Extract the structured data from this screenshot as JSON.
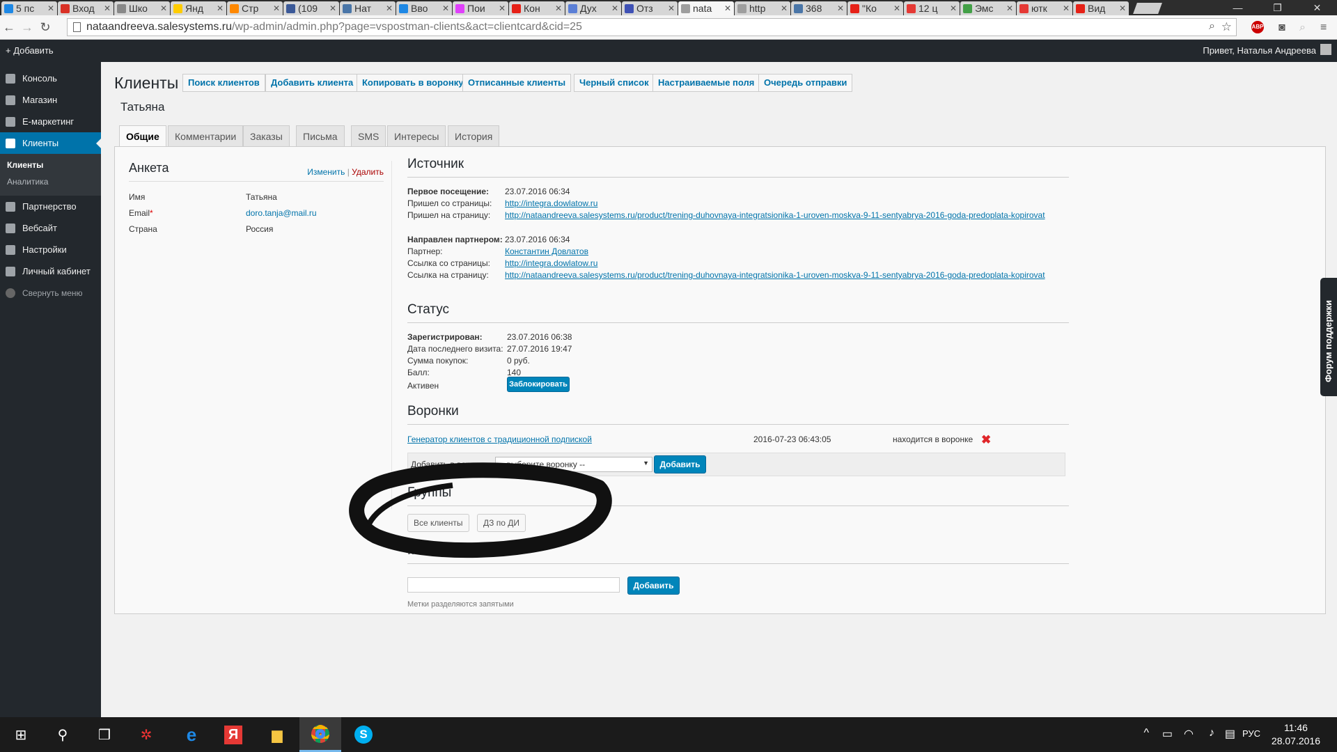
{
  "browser": {
    "tabs": [
      {
        "label": "5 пс",
        "color": "#1e88e5"
      },
      {
        "label": "Вход",
        "color": "#d93025"
      },
      {
        "label": "Шко",
        "color": "#888888"
      },
      {
        "label": "Янд",
        "color": "#ffcc00"
      },
      {
        "label": "Стр",
        "color": "#ff8800"
      },
      {
        "label": "(109",
        "color": "#3b5998"
      },
      {
        "label": "Нат",
        "color": "#4a76a8"
      },
      {
        "label": "Вво",
        "color": "#1e88e5"
      },
      {
        "label": "Пои",
        "color": "#e040fb"
      },
      {
        "label": "Кон",
        "color": "#e62117"
      },
      {
        "label": "Дух",
        "color": "#5b7fd6"
      },
      {
        "label": "Отз",
        "color": "#3f51b5"
      },
      {
        "label": "nata",
        "color": "#9e9e9e",
        "active": true
      },
      {
        "label": "http",
        "color": "#9e9e9e"
      },
      {
        "label": "368",
        "color": "#4a76a8"
      },
      {
        "label": "\"Ко",
        "color": "#e62117"
      },
      {
        "label": "12 ц",
        "color": "#e53935"
      },
      {
        "label": "Эмс",
        "color": "#43a047"
      },
      {
        "label": "ютк",
        "color": "#e53935"
      },
      {
        "label": "Вид",
        "color": "#e62117"
      }
    ],
    "url_host": "nataandreeva.salesystems.ru",
    "url_path": "/wp-admin/admin.php?page=vspostman-clients&act=clientcard&cid=25",
    "abp": "ABP"
  },
  "adminbar": {
    "add": "Добавить",
    "hello": "Привет, Наталья Андреева"
  },
  "sidebar": {
    "items_top": [
      {
        "label": "Консоль",
        "icon": "dashboard-icon"
      },
      {
        "label": "Магазин",
        "icon": "store-icon"
      },
      {
        "label": "Е-маркетинг",
        "icon": "marketing-icon"
      },
      {
        "label": "Клиенты",
        "icon": "clients-icon",
        "current": true
      }
    ],
    "sub": [
      "Клиенты",
      "Аналитика"
    ],
    "items_bottom": [
      {
        "label": "Партнерство",
        "icon": "partner-icon"
      },
      {
        "label": "Вебсайт",
        "icon": "website-icon"
      },
      {
        "label": "Настройки",
        "icon": "settings-icon"
      },
      {
        "label": "Личный кабинет",
        "icon": "account-icon"
      }
    ],
    "collapse": "Свернуть меню"
  },
  "page": {
    "title": "Клиенты",
    "buttons": [
      "Поиск клиентов",
      "Добавить клиента",
      "Копировать в воронку",
      "Отписанные клиенты",
      "Черный список",
      "Настраиваемые поля",
      "Очередь отправки"
    ],
    "client_name": "Татьяна",
    "tabs": [
      "Общие",
      "Комментарии",
      "Заказы",
      "Письма",
      "SMS",
      "Интересы",
      "История"
    ]
  },
  "anketa": {
    "title": "Анкета",
    "edit": "Изменить",
    "sep": "|",
    "delete": "Удалить",
    "rows": [
      {
        "k": "Имя",
        "v": "Татьяна"
      },
      {
        "k": "Email",
        "req": "*",
        "v": "doro.tanja@mail.ru"
      },
      {
        "k": "Страна",
        "v": "Россия"
      }
    ]
  },
  "source": {
    "title": "Источник",
    "first_visit_k": "Первое посещение:",
    "first_visit_v": "23.07.2016 06:34",
    "from_page_k": "Пришел со страницы:",
    "from_page_v": "http://integra.dowlatow.ru",
    "to_page_k": "Пришел на страницу:",
    "to_page_v": "http://nataandreeva.salesystems.ru/product/trening-duhovnaya-integratsionika-1-uroven-moskva-9-11-sentyabrya-2016-goda-predoplata-kopirovat",
    "partner_sent_k": "Направлен партнером:",
    "partner_sent_v": "23.07.2016 06:34",
    "partner_k": "Партнер:",
    "partner_v": "Константин Довлатов",
    "link_from_k": "Ссылка со страницы:",
    "link_from_v": "http://integra.dowlatow.ru",
    "link_to_k": "Ссылка на страницу:",
    "link_to_v": "http://nataandreeva.salesystems.ru/product/trening-duhovnaya-integratsionika-1-uroven-moskva-9-11-sentyabrya-2016-goda-predoplata-kopirovat"
  },
  "status": {
    "title": "Статус",
    "reg_k": "Зарегистрирован:",
    "reg_v": "23.07.2016 06:38",
    "last_k": "Дата последнего визита:",
    "last_v": "27.07.2016 19:47",
    "sum_k": "Сумма покупок:",
    "sum_v": "0 руб.",
    "score_k": "Балл:",
    "score_v": "140",
    "active_k": "Активен",
    "block_btn": "Заблокировать"
  },
  "funnels": {
    "title": "Воронки",
    "name": "Генератор клиентов с традиционной подпиской",
    "date": "2016-07-23 06:43:05",
    "state": "находится в воронке",
    "add_label": "Добавить в воронку:",
    "select_placeholder": "-- выберите воронку --",
    "add_btn": "Добавить"
  },
  "groups": {
    "title": "Группы",
    "items": [
      "Все клиенты",
      "ДЗ по ДИ"
    ]
  },
  "tags": {
    "title": "Метки",
    "add_btn": "Добавить",
    "hint": "Метки разделяются запятыми"
  },
  "support": "Форум поддержки",
  "taskbar": {
    "lang": "РУС",
    "time": "11:46",
    "date": "28.07.2016"
  }
}
